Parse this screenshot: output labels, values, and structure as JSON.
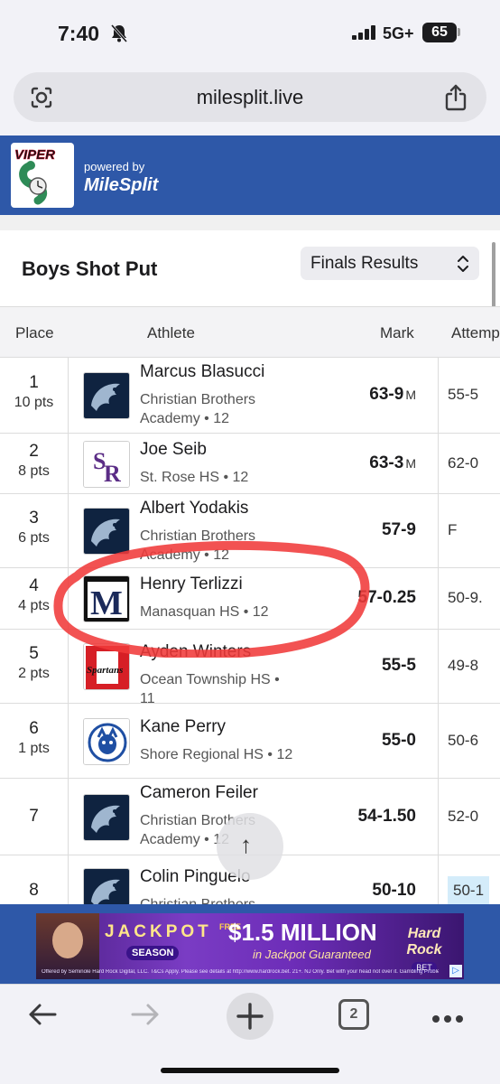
{
  "status": {
    "time": "7:40",
    "network": "5G+",
    "battery": "65"
  },
  "browser": {
    "url": "milesplit.live"
  },
  "header": {
    "logo_alt": "VIPER",
    "powered_by": "powered by",
    "brand": "MileSplit"
  },
  "event": {
    "title": "Boys Shot Put",
    "select_value": "Finals Results"
  },
  "table": {
    "columns": {
      "place": "Place",
      "athlete": "Athlete",
      "mark": "Mark",
      "attempts": "Attemp"
    },
    "rows": [
      {
        "place": "1",
        "pts": "10 pts",
        "name": "Marcus Blasucci",
        "team": "Christian Brothers Academy • 12",
        "mark": "63-9",
        "unit": "M",
        "attempt": "55-5",
        "logo": "cba"
      },
      {
        "place": "2",
        "pts": "8 pts",
        "name": "Joe Seib",
        "team": "St. Rose HS • 12",
        "mark": "63-3",
        "unit": "M",
        "attempt": "62-0",
        "logo": "sr"
      },
      {
        "place": "3",
        "pts": "6 pts",
        "name": "Albert Yodakis",
        "team": "Christian Brothers Academy • 12",
        "mark": "57-9",
        "unit": "",
        "attempt": "F",
        "logo": "cba"
      },
      {
        "place": "4",
        "pts": "4 pts",
        "name": "Henry Terlizzi",
        "team": "Manasquan HS • 12",
        "mark": "57-0.25",
        "unit": "",
        "attempt": "50-9.",
        "logo": "m"
      },
      {
        "place": "5",
        "pts": "2 pts",
        "name": "Ayden Winters",
        "team": "Ocean Township HS • 11",
        "mark": "55-5",
        "unit": "",
        "attempt": "49-8",
        "logo": "o"
      },
      {
        "place": "6",
        "pts": "1 pts",
        "name": "Kane Perry",
        "team": "Shore Regional HS • 12",
        "mark": "55-0",
        "unit": "",
        "attempt": "50-6",
        "logo": "sh"
      },
      {
        "place": "7",
        "pts": "",
        "name": "Cameron Feiler",
        "team": "Christian Brothers Academy • 12",
        "mark": "54-1.50",
        "unit": "",
        "attempt": "52-0",
        "logo": "cba"
      },
      {
        "place": "8",
        "pts": "",
        "name": "Colin Pinguelo",
        "team": "Christian Brothers",
        "mark": "50-10",
        "unit": "",
        "attempt": "50-1",
        "logo": "cba"
      }
    ]
  },
  "ad": {
    "jackpot": "JACKPOT",
    "season": "SEASON",
    "free": "FREE",
    "million": "$1.5 MILLION",
    "guarantee": "in Jackpot Guaranteed",
    "brand": "Hard Rock",
    "brand_sub": "BET",
    "fine": "Offered by Seminole Hard Rock Digital, LLC. T&Cs Apply. Please see details at http://www.hardrock.bet. 21+. NJ Only. Bet with your head not over it. Gambling Problem? Call 1-800-GAMBLER"
  },
  "toolbar": {
    "tab_count": "2"
  },
  "colors": {
    "brand_blue": "#2e58a8",
    "annotation": "#f03a3a"
  }
}
